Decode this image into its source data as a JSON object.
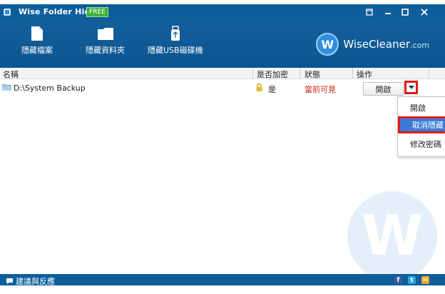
{
  "window": {
    "title": "Wise Folder Hider",
    "badge": "FREE",
    "controls": {
      "icons": [
        "restore-icon",
        "minimize-icon",
        "maximize-icon",
        "close-icon"
      ]
    }
  },
  "toolbar": {
    "hide_file": "隱藏檔案",
    "hide_folder": "隱藏資料夾",
    "hide_usb": "隱藏USB磁碟機"
  },
  "brand": {
    "name": "WiseCleaner",
    "suffix": ".com",
    "logo_letter": "W"
  },
  "table": {
    "headers": {
      "name": "名稱",
      "encrypted": "是否加密",
      "status": "狀態",
      "action": "操作"
    },
    "rows": [
      {
        "path": "D:\\System Backup",
        "encrypted": "是",
        "status": "當前可見",
        "button": "開啟"
      }
    ]
  },
  "menu": {
    "items": [
      "開啟",
      "取消隱藏",
      "修改密碼"
    ],
    "highlighted": "取消隱藏"
  },
  "statusbar": {
    "feedback": "建議與反應"
  },
  "colors": {
    "titlebar": "#0e5e9b",
    "status_red": "#d0241a",
    "highlight_red": "#e11a1a",
    "menu_selected": "#3a7bd5"
  }
}
